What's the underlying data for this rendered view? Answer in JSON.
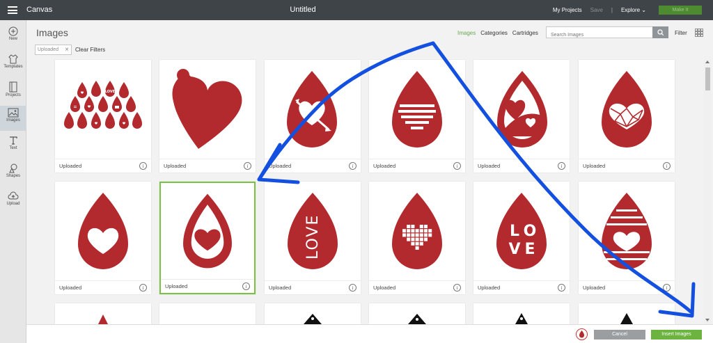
{
  "colors": {
    "accent": "#7cc242",
    "heart_red": "#b22a2e",
    "topbar": "#3e4448",
    "annotation": "#1450e0"
  },
  "topbar": {
    "app_title": "Canvas",
    "doc_title": "Untitled",
    "my_projects": "My Projects",
    "save": "Save",
    "separator": "|",
    "explore": "Explore",
    "make": "Make It"
  },
  "sidebar": {
    "items": [
      {
        "label": "New",
        "icon": "plus-icon"
      },
      {
        "label": "Templates",
        "icon": "shirt-icon"
      },
      {
        "label": "Projects",
        "icon": "projects-icon"
      },
      {
        "label": "Images",
        "icon": "image-icon",
        "active": true
      },
      {
        "label": "Text",
        "icon": "text-icon"
      },
      {
        "label": "Shapes",
        "icon": "shapes-icon"
      },
      {
        "label": "Upload",
        "icon": "upload-icon"
      }
    ]
  },
  "header": {
    "title": "Images",
    "tabs": [
      {
        "label": "Images",
        "active": true
      },
      {
        "label": "Categories"
      },
      {
        "label": "Cartridges"
      }
    ],
    "search_placeholder": "Search Images",
    "filter": "Filter"
  },
  "filters": {
    "chip": "Uploaded",
    "clear": "Clear Filters"
  },
  "cards": [
    {
      "label": "Uploaded",
      "design": "collage"
    },
    {
      "label": "Uploaded",
      "design": "heart-tag"
    },
    {
      "label": "Uploaded",
      "design": "drop-arrow"
    },
    {
      "label": "Uploaded",
      "design": "drop-stripe-heart"
    },
    {
      "label": "Uploaded",
      "design": "drop-split-heart"
    },
    {
      "label": "Uploaded",
      "design": "drop-mosaic"
    },
    {
      "label": "Uploaded",
      "design": "drop-heart"
    },
    {
      "label": "Uploaded",
      "design": "drop-heart-ring",
      "selected": true
    },
    {
      "label": "Uploaded",
      "design": "drop-love-vertical"
    },
    {
      "label": "Uploaded",
      "design": "drop-pixel-heart"
    },
    {
      "label": "Uploaded",
      "design": "drop-love-block"
    },
    {
      "label": "Uploaded",
      "design": "drop-stripes-heart"
    }
  ],
  "footer": {
    "cancel": "Cancel",
    "insert": "Insert Images"
  },
  "love_text": {
    "l": "L",
    "o": "O",
    "v": "V",
    "e": "E",
    "love": "LOVE"
  }
}
